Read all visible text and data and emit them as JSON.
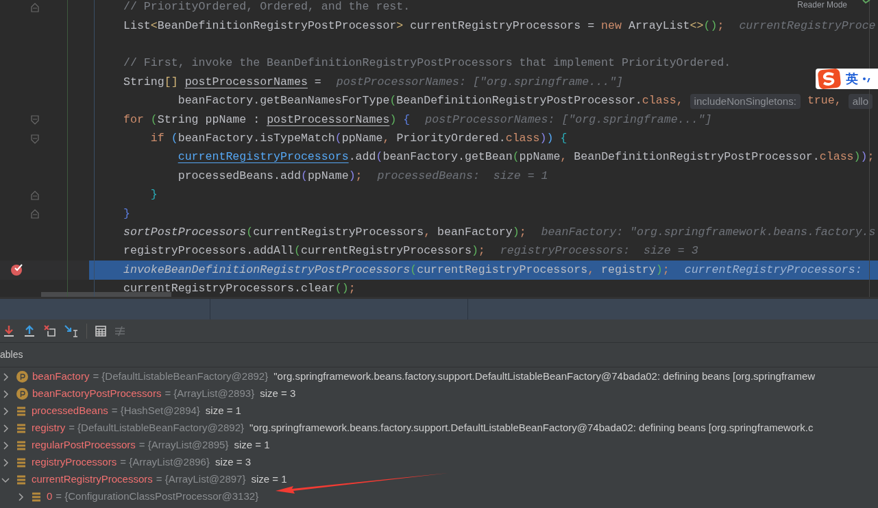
{
  "editor": {
    "reader_mode": "Reader Mode",
    "lines": [
      {
        "current": false,
        "breakpoint": false,
        "fold": {
          "kind": "close"
        },
        "segments": [
          {
            "kind": "code",
            "tokens": [
              {
                "text": "// PriorityOrdered, Ordered, and the rest.",
                "kind": "comment"
              }
            ]
          }
        ]
      },
      {
        "current": false,
        "breakpoint": false,
        "segments": [
          {
            "kind": "code",
            "tokens": [
              {
                "text": "List",
                "kind": "plain"
              },
              {
                "text": "<",
                "kind": "bracket"
              },
              {
                "text": "BeanDefinitionRegistryPostProcessor",
                "kind": "plain"
              },
              {
                "text": ">",
                "kind": "bracket"
              },
              {
                "text": " currentRegistryProcessors = ",
                "kind": "plain"
              },
              {
                "text": "new",
                "kind": "keyword"
              },
              {
                "text": " ArrayList",
                "kind": "plain"
              },
              {
                "text": "<>",
                "kind": "bracket"
              },
              {
                "text": "()",
                "kind": "paren_green"
              },
              {
                "text": ";",
                "kind": "punct"
              }
            ]
          },
          {
            "kind": "hint",
            "text": "currentRegistryProce"
          }
        ]
      },
      {
        "current": false,
        "breakpoint": false
      },
      {
        "current": false,
        "breakpoint": false,
        "segments": [
          {
            "kind": "code",
            "tokens": [
              {
                "text": "// First, invoke the BeanDefinitionRegistryPostProcessors that implement PriorityOrdered.",
                "kind": "comment"
              }
            ]
          }
        ]
      },
      {
        "current": false,
        "breakpoint": false,
        "segments": [
          {
            "kind": "code",
            "tokens": [
              {
                "text": "String",
                "kind": "plain"
              },
              {
                "text": "[] ",
                "kind": "bracket"
              },
              {
                "text": "postProcessorNames",
                "kind": "underlined"
              },
              {
                "text": " =",
                "kind": "plain"
              }
            ]
          },
          {
            "kind": "hint",
            "text": "postProcessorNames: [\"org.springframe...\"]"
          }
        ]
      },
      {
        "current": false,
        "breakpoint": false,
        "segments": [
          {
            "kind": "code",
            "tokens": [
              {
                "text": "        beanFactory.getBeanNamesForType",
                "kind": "plain"
              },
              {
                "text": "(",
                "kind": "paren_green"
              },
              {
                "text": "BeanDefinitionRegistryPostProcessor.",
                "kind": "plain"
              },
              {
                "text": "class",
                "kind": "keyword"
              },
              {
                "text": ",",
                "kind": "punct"
              }
            ]
          },
          {
            "kind": "inlay",
            "text": "includeNonSingletons:"
          },
          {
            "kind": "code",
            "tokens": [
              {
                "text": "true",
                "kind": "keyword"
              },
              {
                "text": ",",
                "kind": "punct"
              }
            ]
          },
          {
            "kind": "inlay",
            "text": "allo"
          }
        ]
      },
      {
        "current": false,
        "breakpoint": false,
        "fold": {
          "kind": "open"
        },
        "segments": [
          {
            "kind": "code",
            "tokens": [
              {
                "text": "for ",
                "kind": "keyword"
              },
              {
                "text": "(",
                "kind": "paren_green"
              },
              {
                "text": "String ppName : ",
                "kind": "plain"
              },
              {
                "text": "postProcessorNames",
                "kind": "underlined"
              },
              {
                "text": ") ",
                "kind": "paren_green"
              },
              {
                "text": "{",
                "kind": "paren_blue"
              }
            ]
          },
          {
            "kind": "hint",
            "text": "postProcessorNames: [\"org.springframe...\"]"
          }
        ]
      },
      {
        "current": false,
        "breakpoint": false,
        "fold": {
          "kind": "open"
        },
        "segments": [
          {
            "kind": "code",
            "tokens": [
              {
                "text": "    if ",
                "kind": "keyword"
              },
              {
                "text": "(",
                "kind": "paren_sky"
              },
              {
                "text": "beanFactory.isTypeMatch",
                "kind": "plain"
              },
              {
                "text": "(",
                "kind": "paren_violet"
              },
              {
                "text": "ppName",
                "kind": "plain"
              },
              {
                "text": ",",
                "kind": "punct"
              },
              {
                "text": " PriorityOrdered.",
                "kind": "plain"
              },
              {
                "text": "class",
                "kind": "keyword"
              },
              {
                "text": ")",
                "kind": "paren_violet"
              },
              {
                "text": ") ",
                "kind": "paren_sky"
              },
              {
                "text": "{",
                "kind": "brace_teal"
              }
            ]
          }
        ]
      },
      {
        "current": false,
        "breakpoint": false,
        "segments": [
          {
            "kind": "code",
            "tokens": [
              {
                "text": "        currentRegistryProcessors",
                "kind": "link"
              },
              {
                "text": ".add",
                "kind": "plain"
              },
              {
                "text": "(",
                "kind": "paren_violet"
              },
              {
                "text": "beanFactory.getBean",
                "kind": "plain"
              },
              {
                "text": "(",
                "kind": "paren_green"
              },
              {
                "text": "ppName",
                "kind": "plain"
              },
              {
                "text": ",",
                "kind": "punct"
              },
              {
                "text": " BeanDefinitionRegistryPostProcessor.",
                "kind": "plain"
              },
              {
                "text": "class",
                "kind": "keyword"
              },
              {
                "text": ")",
                "kind": "paren_green"
              },
              {
                "text": ")",
                "kind": "paren_violet"
              },
              {
                "text": ";",
                "kind": "punct"
              }
            ]
          }
        ]
      },
      {
        "current": false,
        "breakpoint": false,
        "segments": [
          {
            "kind": "code",
            "tokens": [
              {
                "text": "        processedBeans.add",
                "kind": "plain"
              },
              {
                "text": "(",
                "kind": "paren_violet"
              },
              {
                "text": "ppName",
                "kind": "plain"
              },
              {
                "text": ")",
                "kind": "paren_violet"
              },
              {
                "text": ";",
                "kind": "punct"
              }
            ]
          },
          {
            "kind": "hint",
            "text": "processedBeans:  size = 1"
          }
        ]
      },
      {
        "current": false,
        "breakpoint": false,
        "fold": {
          "kind": "close"
        },
        "segments": [
          {
            "kind": "code",
            "tokens": [
              {
                "text": "    }",
                "kind": "brace_teal"
              }
            ]
          }
        ]
      },
      {
        "current": false,
        "breakpoint": false,
        "fold": {
          "kind": "close"
        },
        "segments": [
          {
            "kind": "code",
            "tokens": [
              {
                "text": "}",
                "kind": "paren_blue"
              }
            ]
          }
        ]
      },
      {
        "current": false,
        "breakpoint": false,
        "segments": [
          {
            "kind": "code",
            "tokens": [
              {
                "text": "sortPostProcessors",
                "kind": "italic"
              },
              {
                "text": "(",
                "kind": "paren_green"
              },
              {
                "text": "currentRegistryProcessors",
                "kind": "plain"
              },
              {
                "text": ",",
                "kind": "punct"
              },
              {
                "text": " beanFactory",
                "kind": "plain"
              },
              {
                "text": ")",
                "kind": "paren_green"
              },
              {
                "text": ";",
                "kind": "punct"
              }
            ]
          },
          {
            "kind": "hint",
            "text": "beanFactory: \"org.springframework.beans.factory.s"
          }
        ]
      },
      {
        "current": false,
        "breakpoint": false,
        "segments": [
          {
            "kind": "code",
            "tokens": [
              {
                "text": "registryProcessors.addAll",
                "kind": "plain"
              },
              {
                "text": "(",
                "kind": "paren_green"
              },
              {
                "text": "currentRegistryProcessors",
                "kind": "plain"
              },
              {
                "text": ")",
                "kind": "paren_green"
              },
              {
                "text": ";",
                "kind": "punct"
              }
            ]
          },
          {
            "kind": "hint",
            "text": "registryProcessors:  size = 3"
          }
        ]
      },
      {
        "current": true,
        "breakpoint": true,
        "segments": [
          {
            "kind": "code",
            "tokens": [
              {
                "text": "invokeBeanDefinitionRegistryPostProcessors",
                "kind": "italic"
              },
              {
                "text": "(",
                "kind": "paren_green"
              },
              {
                "text": "currentRegistryProcessors",
                "kind": "plain"
              },
              {
                "text": ",",
                "kind": "punct"
              },
              {
                "text": " registry",
                "kind": "plain"
              },
              {
                "text": ")",
                "kind": "paren_green"
              },
              {
                "text": ";",
                "kind": "punct"
              }
            ]
          },
          {
            "kind": "hint",
            "text": "currentRegistryProcessors:"
          }
        ]
      },
      {
        "current": false,
        "breakpoint": false,
        "segments": [
          {
            "kind": "code",
            "tokens": [
              {
                "text": "currentRegistryProcessors.clear",
                "kind": "plain"
              },
              {
                "text": "()",
                "kind": "paren_green"
              },
              {
                "text": ";",
                "kind": "punct"
              }
            ]
          }
        ]
      }
    ]
  },
  "ime_indicator": {
    "label": "英"
  },
  "variables": {
    "title": "ables",
    "items": [
      {
        "kind": "param",
        "expanded": false,
        "name": "beanFactory",
        "type": "= {DefaultListableBeanFactory@2892}",
        "value": "\"org.springframework.beans.factory.support.DefaultListableBeanFactory@74bada02: defining beans [org.springframew"
      },
      {
        "kind": "param",
        "expanded": false,
        "name": "beanFactoryPostProcessors",
        "type": "= {ArrayList@2893}",
        "value": "size = 3"
      },
      {
        "kind": "field",
        "expanded": false,
        "name": "processedBeans",
        "type": "= {HashSet@2894}",
        "value": "size = 1"
      },
      {
        "kind": "field",
        "expanded": false,
        "name": "registry",
        "type": "= {DefaultListableBeanFactory@2892}",
        "value": "\"org.springframework.beans.factory.support.DefaultListableBeanFactory@74bada02: defining beans [org.springframework.c"
      },
      {
        "kind": "field",
        "expanded": false,
        "name": "regularPostProcessors",
        "type": "= {ArrayList@2895}",
        "value": "size = 1"
      },
      {
        "kind": "field",
        "expanded": false,
        "name": "registryProcessors",
        "type": "= {ArrayList@2896}",
        "value": "size = 3"
      },
      {
        "kind": "field",
        "expanded": true,
        "name": "currentRegistryProcessors",
        "type": "= {ArrayList@2897}",
        "value": "size = 1",
        "children": [
          {
            "kind": "field",
            "expanded": false,
            "name": "0",
            "type": "= {ConfigurationClassPostProcessor@3132}"
          }
        ]
      }
    ]
  }
}
